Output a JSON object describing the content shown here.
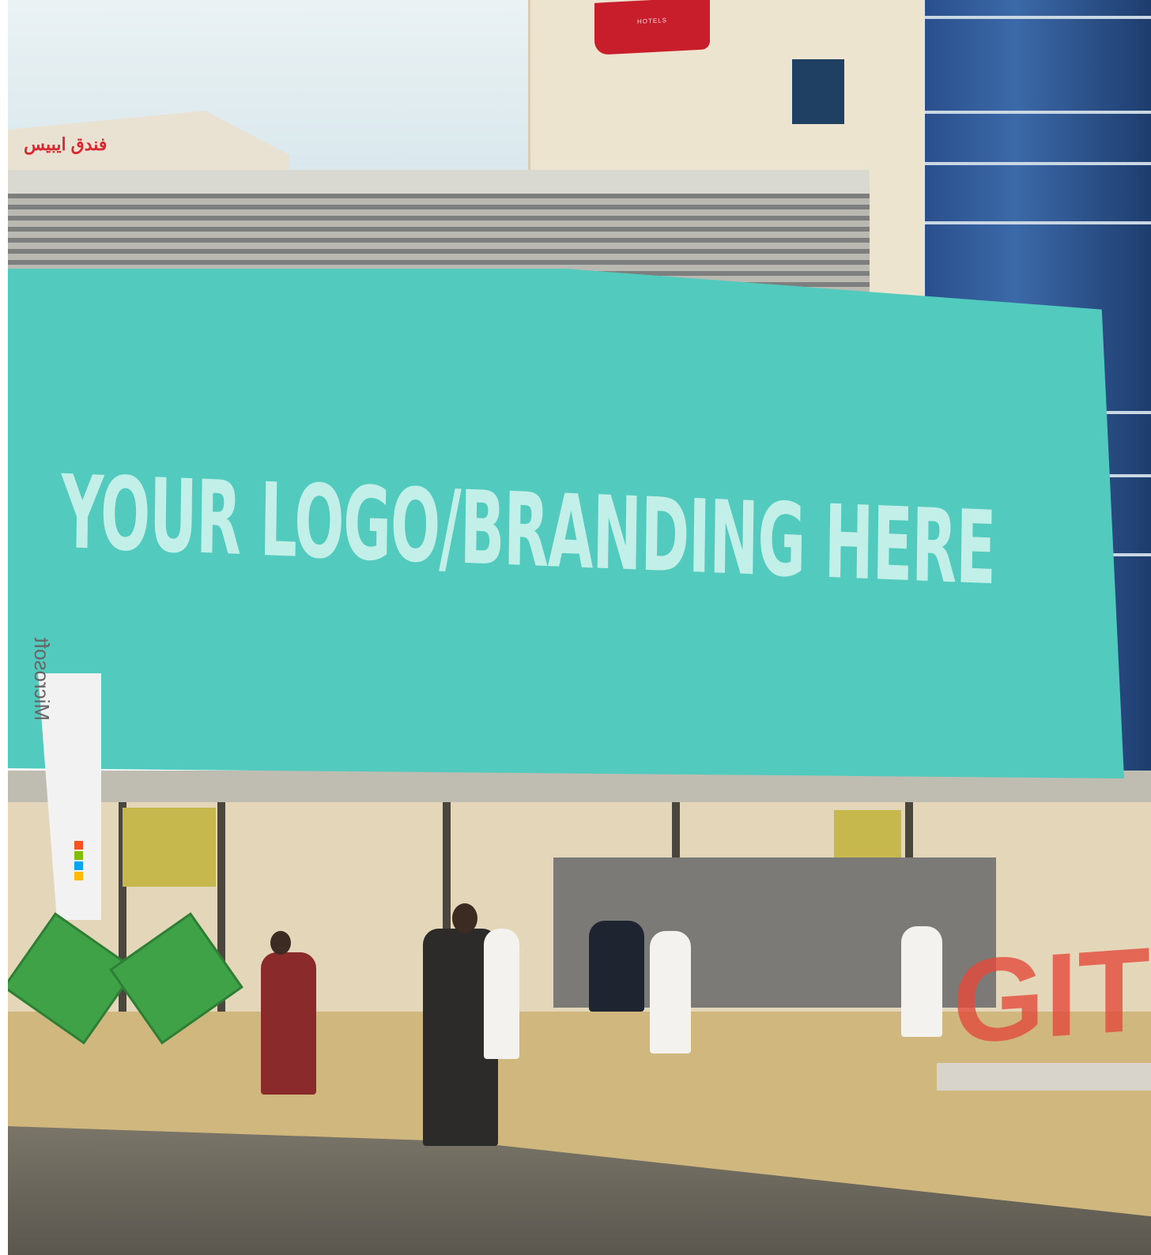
{
  "scene": {
    "description_colors": {
      "billboard": "#52cabd",
      "billboard_text": "#c2efe8",
      "hotel_sign": "#c81e2c",
      "plaza": "#cfb77e",
      "glass_tower": "#2a4f8c"
    },
    "billboard_text": "YOUR LOGO/BRANDING HERE",
    "hotel_sign_text": "HOTELS",
    "flag_text": "Microsoft",
    "roof_sign_text": "فندق ايبيس",
    "exhibit_sign_text": "GITEX"
  }
}
